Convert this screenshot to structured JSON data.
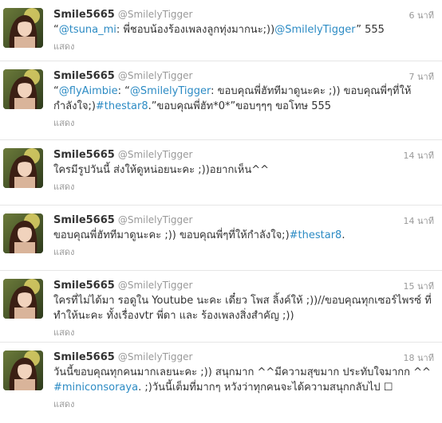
{
  "show_label": "แสดง",
  "tweets": [
    {
      "name": "Smile5665",
      "handle": "@SmilelyTigger",
      "time": "6 นาที",
      "parts": [
        {
          "t": "“"
        },
        {
          "t": "@tsuna_mi",
          "link": true
        },
        {
          "t": ": พี่ชอบน้องร้องเพลงลูกทุ่งมากนะ;))"
        },
        {
          "t": "@SmilelyTigger",
          "link": true
        },
        {
          "t": "” 555"
        }
      ]
    },
    {
      "name": "Smile5665",
      "handle": "@SmilelyTigger",
      "time": "7 นาที",
      "parts": [
        {
          "t": "“"
        },
        {
          "t": "@flyAimbie",
          "link": true
        },
        {
          "t": ": “"
        },
        {
          "t": "@SmilelyTigger",
          "link": true
        },
        {
          "t": ": ขอบคุณพี่ฮัททีมาดูนะคะ ;)) ขอบคุณพี่ๆที่ให้กำลังใจ;)"
        },
        {
          "t": "#thestar8",
          "link": true
        },
        {
          "t": ".”ขอบคุณพี่ฮัท*0*”ขอบๆๆๆ ขอโทษ 555"
        }
      ]
    },
    {
      "name": "Smile5665",
      "handle": "@SmilelyTigger",
      "time": "14 นาที",
      "parts": [
        {
          "t": "ใครมีรูปวันนี้ ส่งให้ดูหน่อยนะคะ ;))อยากเห็น^^"
        }
      ]
    },
    {
      "name": "Smile5665",
      "handle": "@SmilelyTigger",
      "time": "14 นาที",
      "parts": [
        {
          "t": "ขอบคุณพี่ฮัททีมาดูนะคะ ;)) ขอบคุณพี่ๆที่ให้กำลังใจ;)"
        },
        {
          "t": "#thestar8",
          "link": true
        },
        {
          "t": "."
        }
      ]
    },
    {
      "name": "Smile5665",
      "handle": "@SmilelyTigger",
      "time": "15 นาที",
      "parts": [
        {
          "t": "ใครที่ไม่ได้มา รอดูใน Youtube นะคะ เดี๋ยว โพส ลิ้งค์ให้ ;))//ขอบคุณทุกเซอร์ไพรซ์ ที่ทำให้นะคะ ทั้งเรื่องvtr พี่ดา และ ร้องเพลงสิ่งสำคัญ ;))"
        }
      ]
    },
    {
      "name": "Smile5665",
      "handle": "@SmilelyTigger",
      "time": "18 นาที",
      "parts": [
        {
          "t": "วันนี้ขอบคุณทุกคนมากเลยนะคะ ;)) สนุกมาก ^^มีความสุขมาก ประทับใจมากก ^^ "
        },
        {
          "t": "#miniconsoraya",
          "link": true
        },
        {
          "t": ". ;)วันนี้เต็มที่มากๆ หวังว่าทุกคนจะได้ความสนุกกลับไป ☐"
        }
      ]
    }
  ]
}
